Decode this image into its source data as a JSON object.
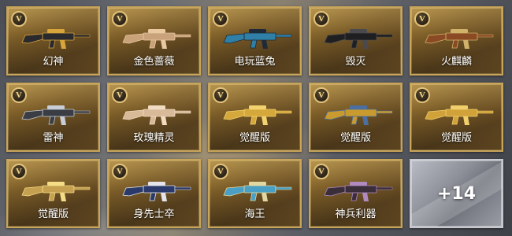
{
  "badge_letter": "V",
  "items": [
    {
      "name": "幻神",
      "accent": "#2a2a2e",
      "trim": "#d7a53c"
    },
    {
      "name": "金色蔷薇",
      "accent": "#c9a27a",
      "trim": "#e8c9a0"
    },
    {
      "name": "电玩蓝兔",
      "accent": "#2f7fa6",
      "trim": "#1e2a38"
    },
    {
      "name": "毁灭",
      "accent": "#1f1f22",
      "trim": "#4a4a4e"
    },
    {
      "name": "火麒麟",
      "accent": "#8a4a24",
      "trim": "#d0b26a"
    },
    {
      "name": "雷神",
      "accent": "#3a3d44",
      "trim": "#c8cdd6"
    },
    {
      "name": "玫瑰精灵",
      "accent": "#d8b998",
      "trim": "#f1dcc2"
    },
    {
      "name": "觉醒版",
      "accent": "#d4a83a",
      "trim": "#f3d270"
    },
    {
      "name": "觉醒版",
      "accent": "#c99a2e",
      "trim": "#4a6fa0"
    },
    {
      "name": "觉醒版",
      "accent": "#d1a23a",
      "trim": "#f0cf6c"
    },
    {
      "name": "觉醒版",
      "accent": "#c4a050",
      "trim": "#f5dc86"
    },
    {
      "name": "身先士卒",
      "accent": "#2a3a6a",
      "trim": "#e4e4ea"
    },
    {
      "name": "海王",
      "accent": "#4aa0c4",
      "trim": "#e1d7a0"
    },
    {
      "name": "神兵利器",
      "accent": "#3a2e3a",
      "trim": "#b08ac0"
    }
  ],
  "more": {
    "label": "+14"
  }
}
